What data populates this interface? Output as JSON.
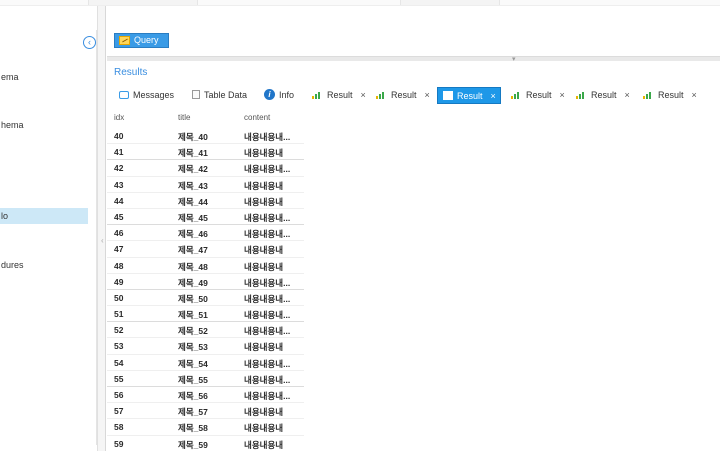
{
  "sidebar": {
    "items": [
      {
        "label": "ema",
        "selected": false
      },
      {
        "label": "hema",
        "selected": false
      },
      {
        "label": "lo",
        "selected": true
      },
      {
        "label": "dures",
        "selected": false
      }
    ]
  },
  "toolbar": {
    "query_label": "Query"
  },
  "results": {
    "title": "Results",
    "tabs": [
      {
        "label": "Messages",
        "icon": "messages-icon",
        "closable": false,
        "active": false
      },
      {
        "label": "Table Data",
        "icon": "table-icon",
        "closable": false,
        "active": false
      },
      {
        "label": "Info",
        "icon": "info-icon",
        "closable": false,
        "active": false
      },
      {
        "label": "Result",
        "icon": "result-icon",
        "closable": true,
        "active": false
      },
      {
        "label": "Result",
        "icon": "result-icon",
        "closable": true,
        "active": false
      },
      {
        "label": "Result",
        "icon": "result-icon",
        "closable": true,
        "active": true
      },
      {
        "label": "Result",
        "icon": "result-icon",
        "closable": true,
        "active": false
      },
      {
        "label": "Result",
        "icon": "result-icon",
        "closable": true,
        "active": false
      },
      {
        "label": "Result",
        "icon": "result-icon",
        "closable": true,
        "active": false
      }
    ],
    "close_glyph": "×",
    "columns": [
      "idx",
      "title",
      "content"
    ],
    "rows": [
      [
        "40",
        "제목_40",
        "내용내용내..."
      ],
      [
        "41",
        "제목_41",
        "내용내용내"
      ],
      [
        "42",
        "제목_42",
        "내용내용내..."
      ],
      [
        "43",
        "제목_43",
        "내용내용내"
      ],
      [
        "44",
        "제목_44",
        "내용내용내"
      ],
      [
        "45",
        "제목_45",
        "내용내용내..."
      ],
      [
        "46",
        "제목_46",
        "내용내용내..."
      ],
      [
        "47",
        "제목_47",
        "내용내용내"
      ],
      [
        "48",
        "제목_48",
        "내용내용내"
      ],
      [
        "49",
        "제목_49",
        "내용내용내..."
      ],
      [
        "50",
        "제목_50",
        "내용내용내..."
      ],
      [
        "51",
        "제목_51",
        "내용내용내..."
      ],
      [
        "52",
        "제목_52",
        "내용내용내..."
      ],
      [
        "53",
        "제목_53",
        "내용내용내"
      ],
      [
        "54",
        "제목_54",
        "내용내용내..."
      ],
      [
        "55",
        "제목_55",
        "내용내용내..."
      ],
      [
        "56",
        "제목_56",
        "내용내용내..."
      ],
      [
        "57",
        "제목_57",
        "내용내용내"
      ],
      [
        "58",
        "제목_58",
        "내용내용내"
      ],
      [
        "59",
        "제목_59",
        "내용내용내"
      ]
    ]
  },
  "colors": {
    "accent": "#3a9be6",
    "active_tab": "#1e98e8",
    "selected_item": "#cde8f7",
    "results_title": "#3a8ee0",
    "chart_icon_green": "#3aa84a",
    "chart_icon_yellow": "#e7b400"
  }
}
